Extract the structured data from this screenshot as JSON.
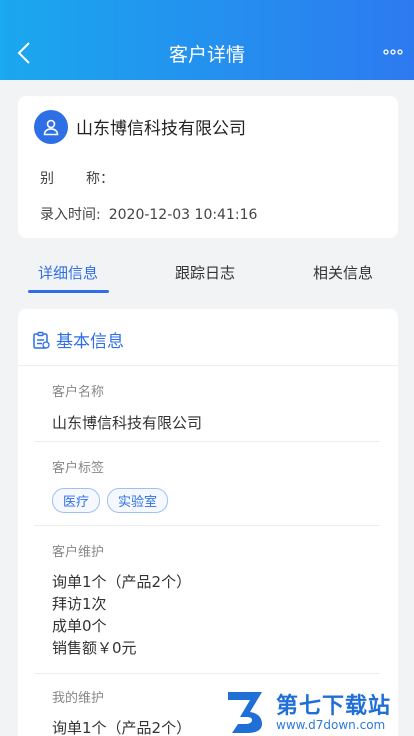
{
  "header": {
    "title": "客户详情"
  },
  "customer": {
    "name": "山东博信科技有限公司",
    "alias_label": "别称：",
    "alias_k1": "别",
    "alias_k2": "称：",
    "time_label": "录入时间:",
    "time_value": "2020-12-03 10:41:16"
  },
  "tabs": [
    "详细信息",
    "跟踪日志",
    "相关信息"
  ],
  "basic": {
    "title": "基本信息",
    "name_label": "客户名称",
    "name_value": "山东博信科技有限公司",
    "tags_label": "客户标签",
    "tags": [
      "医疗",
      "实验室"
    ],
    "maint_label": "客户维护",
    "maint_lines": [
      "询单1个（产品2个）",
      "拜访1次",
      "成单0个",
      "销售额￥0元"
    ],
    "my_label": "我的维护",
    "my_lines": [
      "询单1个（产品2个）"
    ]
  },
  "watermark": {
    "cn": "第七下载站",
    "url": "www.d7down.com"
  },
  "colors": {
    "accent": "#2e6fe6",
    "header_start": "#1aa8ee",
    "header_end": "#2d7af0"
  }
}
